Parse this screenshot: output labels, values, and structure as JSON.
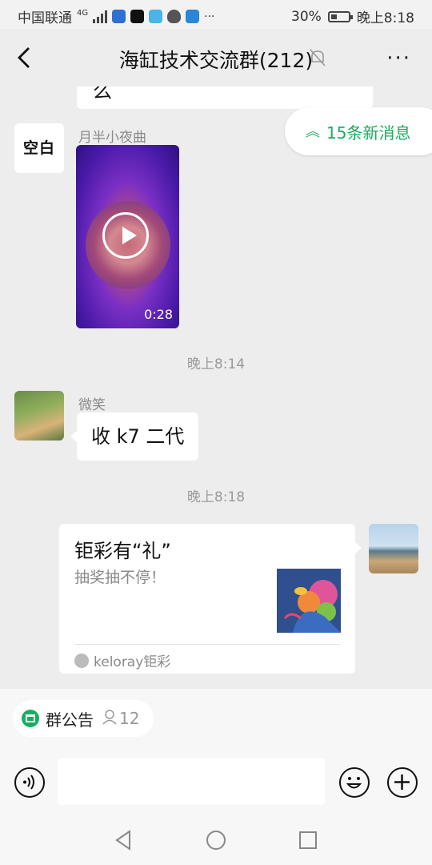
{
  "statusbar": {
    "carrier": "中国联通",
    "network": "4G",
    "battery": "30%",
    "battery_level": 0.3,
    "time": "晚上8:18"
  },
  "header": {
    "title": "海缸技术交流群(212)",
    "more": "···"
  },
  "chat": {
    "partial_text": "么",
    "new_messages": "15条新消息",
    "messages": [
      {
        "sender": "月半小夜曲",
        "avatar_text": "空白",
        "video_duration": "0:28"
      },
      {
        "timestamp": "晚上8:14"
      },
      {
        "sender": "微笑",
        "text": "收 k7 二代"
      },
      {
        "timestamp": "晚上8:18"
      },
      {
        "card_title": "钜彩有“礼”",
        "card_desc": "抽奖抽不停！",
        "card_source": "keloray钜彩"
      }
    ]
  },
  "notice": {
    "label": "群公告",
    "member_count": "12"
  },
  "colors": {
    "accent_green": "#1aad5f",
    "background": "#ededed"
  }
}
